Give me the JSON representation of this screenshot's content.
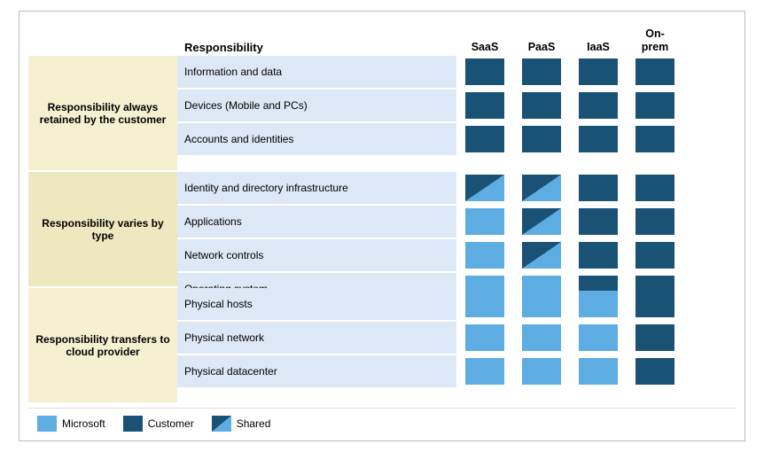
{
  "chart": {
    "title": "Responsibility",
    "columns": [
      "SaaS",
      "PaaS",
      "IaaS",
      "On-\nprem"
    ],
    "groups": [
      {
        "label": "Responsibility always retained by the customer",
        "bg": "#f5f0d0",
        "rows": [
          {
            "label": "Information and data",
            "saas": "customer",
            "paas": "customer",
            "iaas": "customer",
            "onprem": "customer"
          },
          {
            "label": "Devices (Mobile and PCs)",
            "saas": "customer",
            "paas": "customer",
            "iaas": "customer",
            "onprem": "customer"
          },
          {
            "label": "Accounts and identities",
            "saas": "customer",
            "paas": "customer",
            "iaas": "customer",
            "onprem": "customer"
          }
        ]
      },
      {
        "label": "Responsibility varies by type",
        "bg": "#ede8c0",
        "rows": [
          {
            "label": "Identity and directory infrastructure",
            "saas": "shared",
            "paas": "shared",
            "iaas": "customer",
            "onprem": "customer"
          },
          {
            "label": "Applications",
            "saas": "microsoft",
            "paas": "shared",
            "iaas": "customer",
            "onprem": "customer"
          },
          {
            "label": "Network controls",
            "saas": "microsoft",
            "paas": "shared",
            "iaas": "customer",
            "onprem": "customer"
          },
          {
            "label": "Operating system",
            "saas": "microsoft",
            "paas": "microsoft",
            "iaas": "customer",
            "onprem": "customer"
          }
        ]
      },
      {
        "label": "Responsibility transfers to cloud provider",
        "bg": "#f5f0d0",
        "rows": [
          {
            "label": "Physical hosts",
            "saas": "microsoft",
            "paas": "microsoft",
            "iaas": "microsoft",
            "onprem": "customer"
          },
          {
            "label": "Physical network",
            "saas": "microsoft",
            "paas": "microsoft",
            "iaas": "microsoft",
            "onprem": "customer"
          },
          {
            "label": "Physical datacenter",
            "saas": "microsoft",
            "paas": "microsoft",
            "iaas": "microsoft",
            "onprem": "customer"
          }
        ]
      }
    ],
    "legend": [
      {
        "label": "Microsoft",
        "type": "microsoft"
      },
      {
        "label": "Customer",
        "type": "customer"
      },
      {
        "label": "Shared",
        "type": "shared"
      }
    ]
  }
}
